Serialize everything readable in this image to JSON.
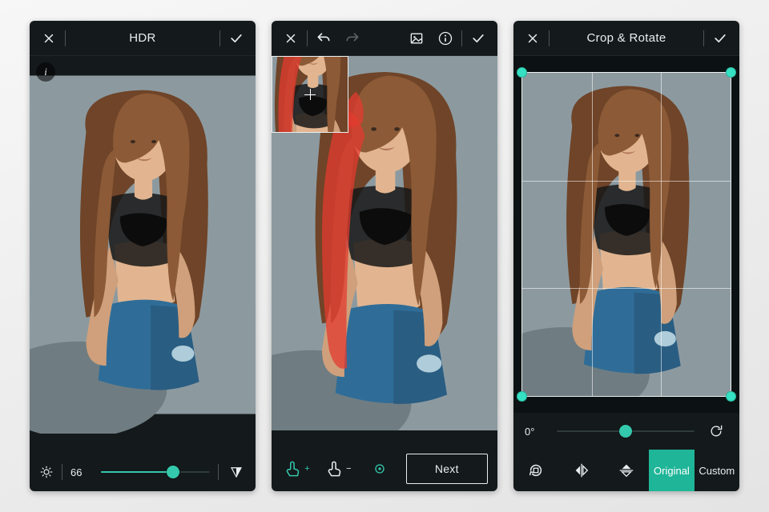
{
  "screens": {
    "hdr": {
      "title": "HDR",
      "brightness_value": "66",
      "brightness_pct": 66
    },
    "brush": {
      "next_label": "Next"
    },
    "crop": {
      "title": "Crop & Rotate",
      "degree_label": "0°",
      "rotate_pct": 50,
      "modes": {
        "original": "Original",
        "custom": "Custom"
      },
      "active_mode": "original"
    }
  },
  "icons": {
    "close": "close-icon",
    "confirm": "checkmark-icon",
    "undo": "undo-icon",
    "redo": "redo-icon",
    "image": "image-icon",
    "info": "info-icon",
    "brightness": "brightness-icon",
    "invert": "invert-triangle-icon",
    "brush_add": "brush-add-icon",
    "brush_remove": "brush-remove-icon",
    "size": "brush-size-icon",
    "rotate": "rotate-icon",
    "flip_h": "flip-horizontal-icon",
    "flip_v": "flip-vertical-icon",
    "reset": "reset-icon"
  }
}
